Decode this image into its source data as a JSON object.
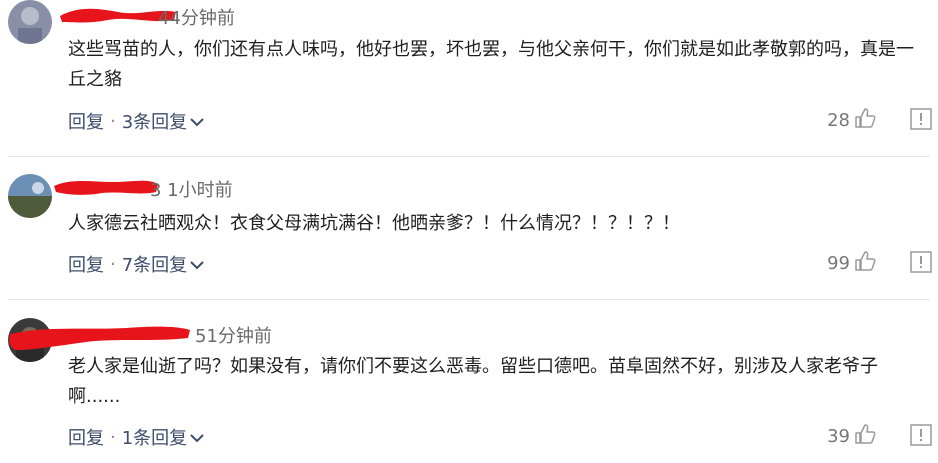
{
  "comments": [
    {
      "time": "44分钟前",
      "text": "这些骂苗的人，你们还有点人味吗，他好也罢，坏也罢，与他父亲何干，你们就是如此孝敬郭的吗，真是一丘之貉",
      "reply_label": "回复",
      "replies_label": "3条回复",
      "likes": "28"
    },
    {
      "time": "3 1小时前",
      "text": "人家德云社晒观众！衣食父母满坑满谷！他晒亲爹？！什么情况？！？！？！",
      "reply_label": "回复",
      "replies_label": "7条回复",
      "likes": "99"
    },
    {
      "time": "51分钟前",
      "text": "老人家是仙逝了吗？如果没有，请你们不要这么恶毒。留些口德吧。苗阜固然不好，别涉及人家老爷子啊......",
      "reply_label": "回复",
      "replies_label": "1条回复",
      "likes": "39"
    }
  ],
  "colors": {
    "redact": "#e8141c",
    "action_link": "#3d4d6b",
    "meta": "#6a6a6a"
  },
  "icons": [
    "thumbs-up-icon",
    "report-icon",
    "chevron-down-icon",
    "avatar"
  ]
}
